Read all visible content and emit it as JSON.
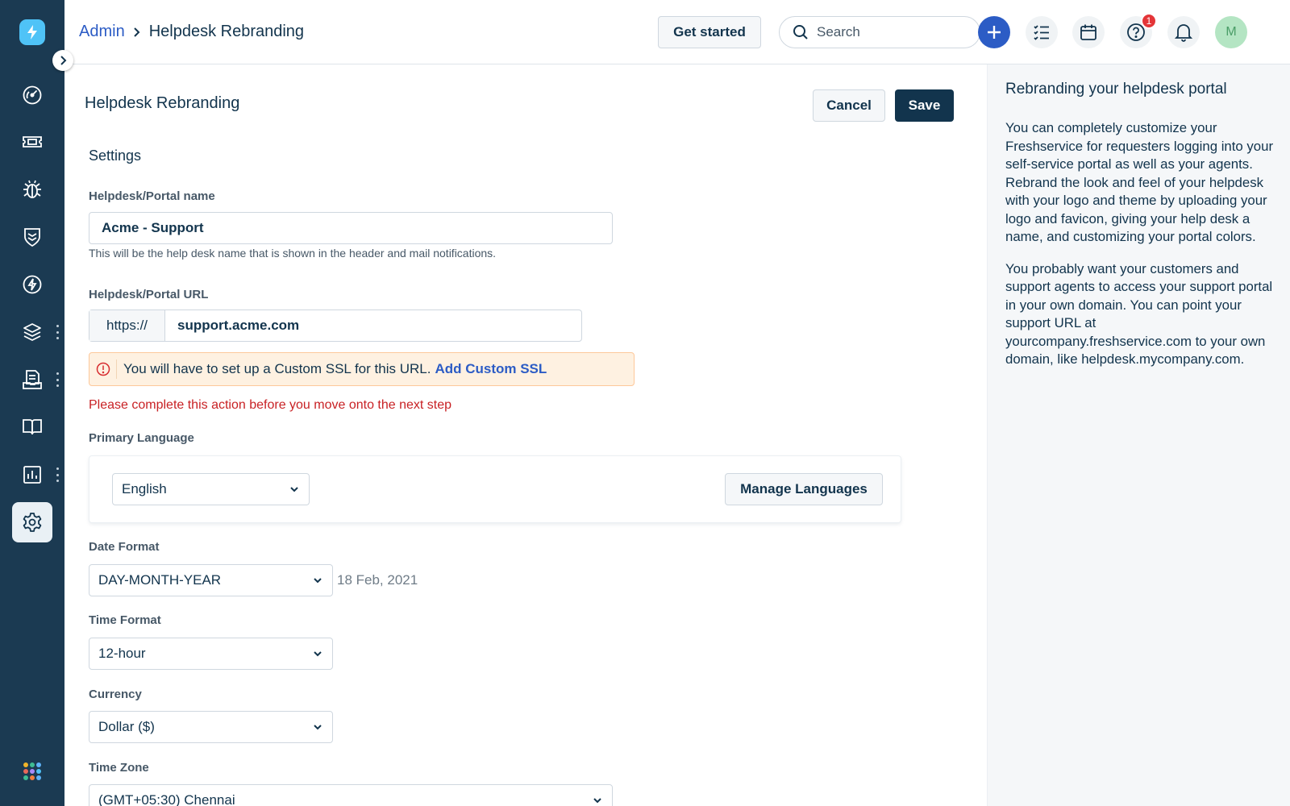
{
  "header": {
    "breadcrumb_root": "Admin",
    "breadcrumb_current": "Helpdesk Rebranding",
    "get_started_label": "Get started",
    "search_placeholder": "Search",
    "help_badge_count": "1",
    "avatar_initial": "M"
  },
  "sidebar": {
    "items": [
      {
        "icon": "dashboard-icon"
      },
      {
        "icon": "tickets-icon"
      },
      {
        "icon": "problems-bug-icon"
      },
      {
        "icon": "changes-shield-icon"
      },
      {
        "icon": "releases-bolt-icon"
      },
      {
        "icon": "assets-layers-icon"
      },
      {
        "icon": "contracts-document-icon"
      },
      {
        "icon": "solutions-book-icon"
      },
      {
        "icon": "reports-chart-icon"
      },
      {
        "icon": "admin-gear-icon",
        "active": true
      }
    ]
  },
  "main": {
    "page_title": "Helpdesk Rebranding",
    "cancel_label": "Cancel",
    "save_label": "Save",
    "settings_title": "Settings",
    "portal_name": {
      "label": "Helpdesk/Portal name",
      "value": "Acme - Support",
      "hint": "This will be the help desk name that is shown in the header and mail notifications."
    },
    "portal_url": {
      "label": "Helpdesk/Portal URL",
      "prefix": "https://",
      "value": "support.acme.com"
    },
    "ssl_alert": {
      "message": "You will have to set up a Custom SSL for this URL.",
      "link": "Add Custom SSL"
    },
    "error_text": "Please complete this action before you move onto the next step",
    "primary_language": {
      "label": "Primary Language",
      "value": "English",
      "manage_label": "Manage Languages"
    },
    "date_format": {
      "label": "Date Format",
      "value": "DAY-MONTH-YEAR",
      "preview": "18 Feb, 2021"
    },
    "time_format": {
      "label": "Time Format",
      "value": "12-hour"
    },
    "currency": {
      "label": "Currency",
      "value": "Dollar ($)"
    },
    "time_zone": {
      "label": "Time Zone",
      "value": "(GMT+05:30) Chennai"
    }
  },
  "help_panel": {
    "title": "Rebranding your helpdesk portal",
    "para1": "You can completely customize your Freshservice for requesters logging into your self-service portal as well as your agents. Rebrand the look and feel of your helpdesk with your logo and theme by uploading your logo and favicon, giving your help desk a name, and customizing your portal colors.",
    "para2": "You probably want your customers and support agents to access your support portal in your own domain. You can point your support URL at yourcompany.freshservice.com to your own domain, like helpdesk.mycompany.com."
  },
  "colors": {
    "sidebar_bg": "#1b3a52",
    "primary": "#2c5cc5",
    "save_bg": "#12344d",
    "error": "#c82124",
    "alert_bg": "#fef1e1"
  }
}
